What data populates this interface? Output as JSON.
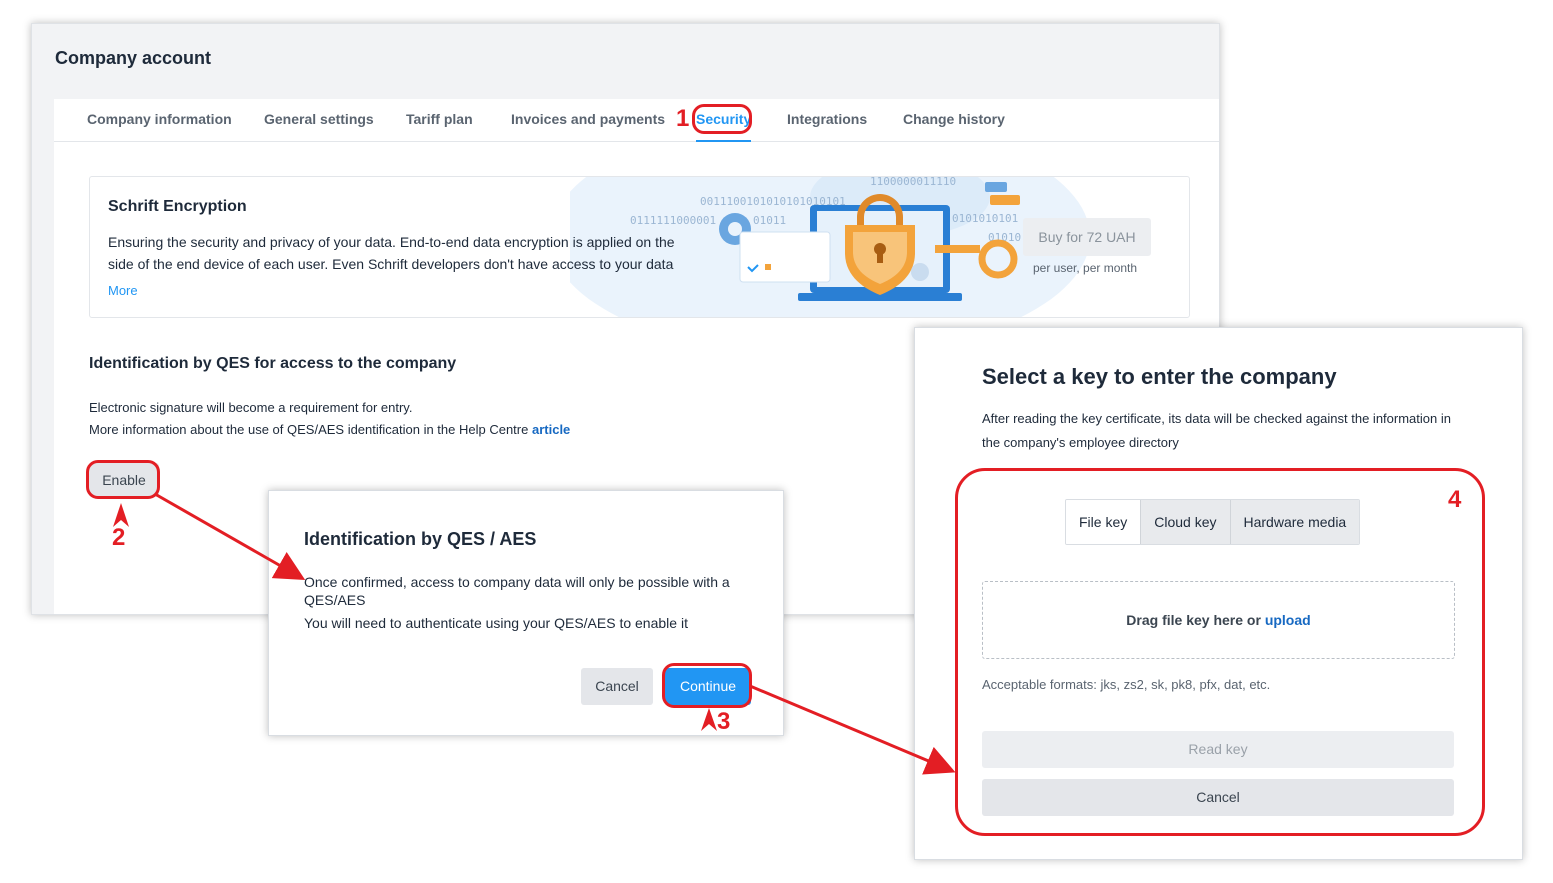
{
  "main": {
    "title": "Company account",
    "tabs": [
      {
        "label": "Company information"
      },
      {
        "label": "General settings"
      },
      {
        "label": "Tariff plan"
      },
      {
        "label": "Invoices and payments"
      },
      {
        "label": "Security"
      },
      {
        "label": "Integrations"
      },
      {
        "label": "Change history"
      }
    ],
    "active_tab": "Security",
    "encryption": {
      "title": "Schrift Encryption",
      "line1": "Ensuring the security and privacy of your data. End-to-end data encryption is applied on the",
      "line2": "side of the end device of each user. Even Schrift developers don't have access to your data",
      "more_link": "More",
      "buy_button": "Buy for 72 UAH",
      "buy_sub": "per user, per month",
      "binary_text": [
        "0011100101010101010101",
        "0111111000001",
        "01011",
        "1100000011110",
        "0101010101",
        "01010",
        "0101"
      ]
    },
    "qes": {
      "title": "Identification by QES for access to the company",
      "line1": "Electronic signature will become a requirement for entry.",
      "line2": "More information about the use of QES/AES identification in the Help Centre",
      "link": "article",
      "enable_button": "Enable"
    }
  },
  "dialog_qes": {
    "title": "Identification by QES / AES",
    "text1": "Once confirmed, access to company data will only be possible with a QES/AES",
    "text2": "You will need to authenticate using your QES/AES to enable it",
    "cancel": "Cancel",
    "continue": "Continue"
  },
  "dialog_key": {
    "title": "Select a key to enter the company",
    "desc": "After reading the key certificate, its data will be checked against the information in the company's employee directory",
    "segments": [
      {
        "label": "File key"
      },
      {
        "label": "Cloud key"
      },
      {
        "label": "Hardware media"
      }
    ],
    "active_segment": "File key",
    "drop_text": "Drag file key here or",
    "drop_link": "upload",
    "formats": "Acceptable formats: jks, zs2, sk, pk8, pfx, dat, etc.",
    "read_button": "Read key",
    "cancel_button": "Cancel"
  },
  "annotations": {
    "step1": "1",
    "step2": "2",
    "step3": "3",
    "step4": "4"
  },
  "colors": {
    "accent": "#2196f3",
    "annotation": "#e31e24",
    "link": "#1769c2"
  }
}
